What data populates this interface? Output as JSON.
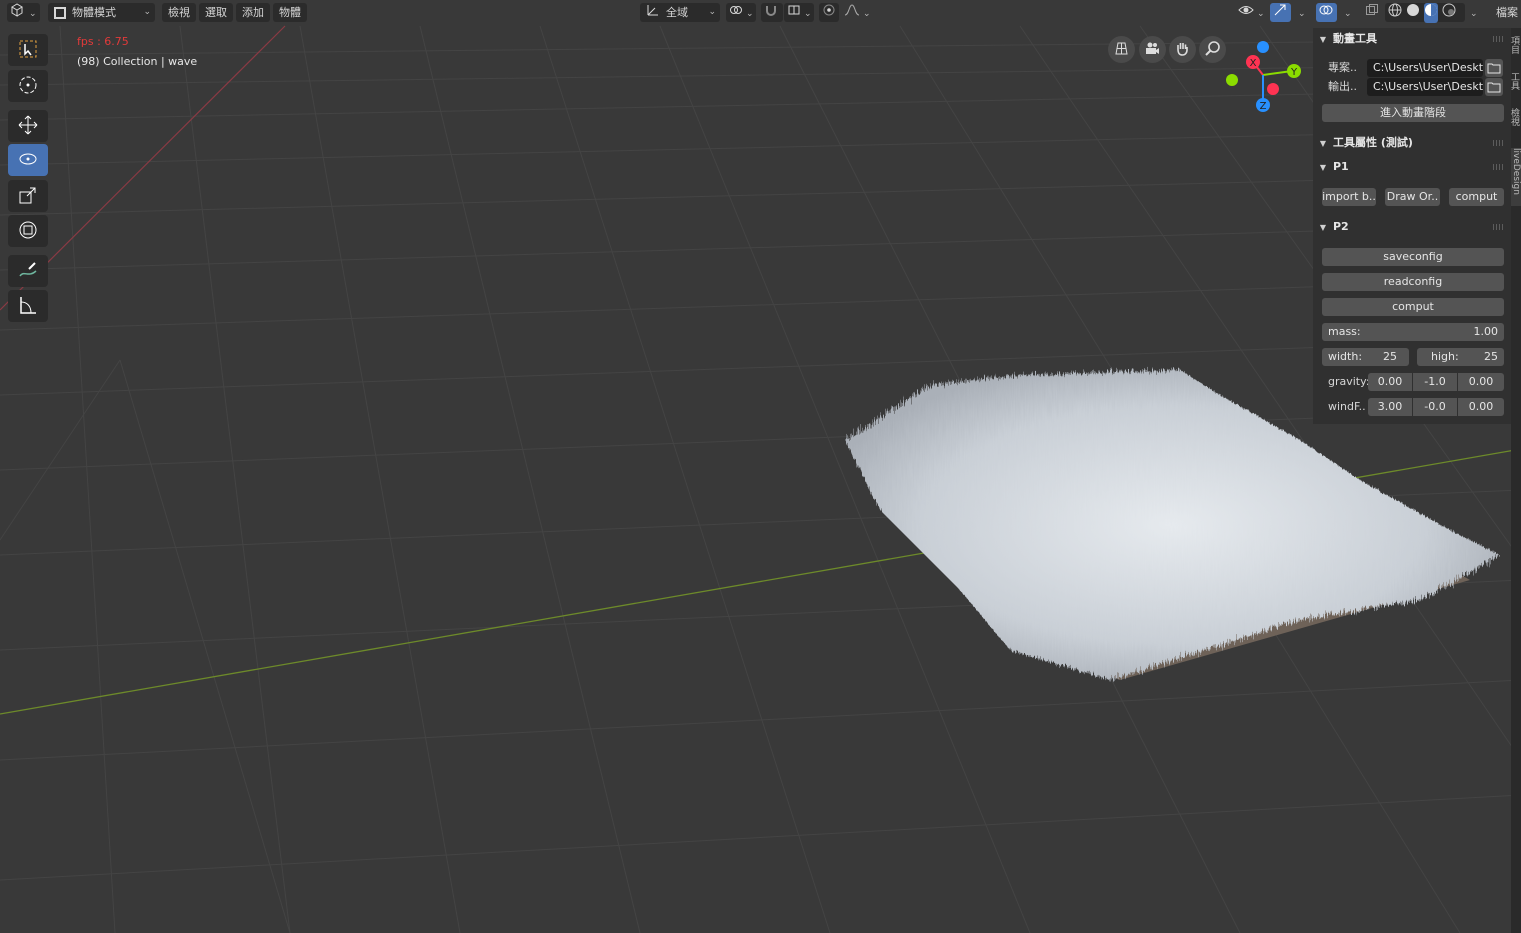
{
  "header": {
    "editor_type_icon": "view3d-icon",
    "mode": "物體模式",
    "menu": [
      "檢視",
      "選取",
      "添加",
      "物體"
    ],
    "orientation": "全域",
    "right_label": "檔案"
  },
  "overlay": {
    "fps": "fps : 6.75",
    "collection": "(98) Collection | wave"
  },
  "toolbar": {
    "tools": [
      "select-box-icon",
      "cursor-icon",
      "move-icon",
      "rotate-icon",
      "scale-icon",
      "transform-icon",
      "annotate-icon",
      "measure-icon"
    ],
    "active": "rotate-icon"
  },
  "gizmo": {
    "axes": [
      "X",
      "Y",
      "Z"
    ],
    "colors": {
      "x": "#ff3352",
      "y": "#8bdc00",
      "z": "#2890ff"
    }
  },
  "sidebar": {
    "panel_anim": {
      "title": "動畫工具",
      "project_label": "專案..",
      "project_value": "C:\\Users\\User\\Deskt..",
      "output_label": "輸出..",
      "output_value": "C:\\Users\\User\\Deskt..",
      "enter_button": "進入動畫階段"
    },
    "panel_props": {
      "title": "工具屬性 (測試)"
    },
    "panel_p1": {
      "title": "P1",
      "buttons": [
        "import b..",
        "Draw Or..",
        "comput"
      ]
    },
    "panel_p2": {
      "title": "P2",
      "saveconfig": "saveconfig",
      "readconfig": "readconfig",
      "comput": "comput",
      "mass_label": "mass:",
      "mass_value": "1.00",
      "width_label": "width:",
      "width_value": "25",
      "high_label": "high:",
      "high_value": "25",
      "gravity_label": "gravity:",
      "gravity": [
        "0.00",
        "-1.0",
        "0.00"
      ],
      "wind_label": "windF..",
      "wind": [
        "3.00",
        "-0.0",
        "0.00"
      ]
    },
    "tabs": [
      "項目",
      "工具",
      "檢視",
      "liveDesign"
    ]
  },
  "colors": {
    "accent": "#4772b3",
    "viewport_bg": "#393939",
    "fps": "#e23a3a"
  }
}
